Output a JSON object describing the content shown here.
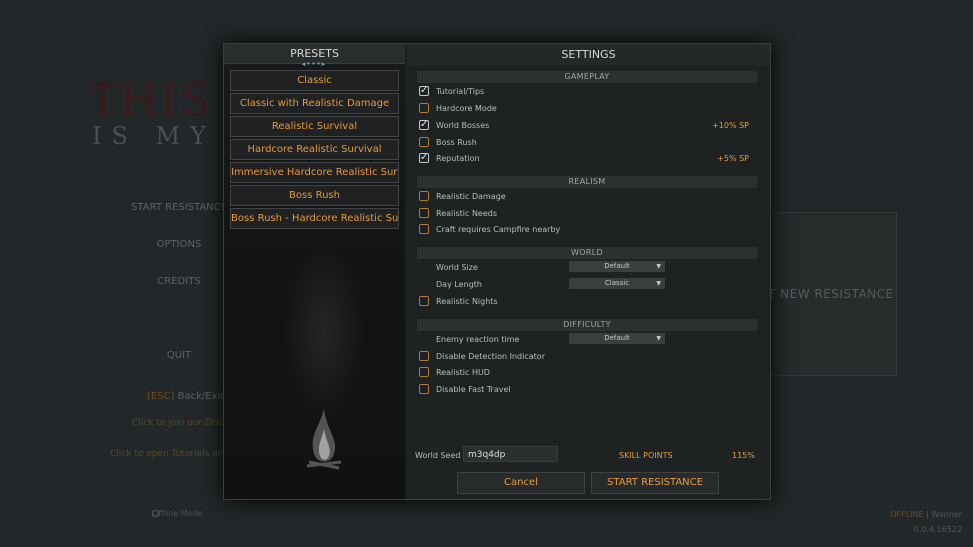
{
  "background": {
    "title_line1": "THIS LA",
    "title_line2": "IS MY L",
    "menu": [
      "START RESISTANCE",
      "OPTIONS",
      "CREDITS",
      "",
      "QUIT"
    ],
    "esc_key": "[ESC]",
    "esc_label": "Back/Exit",
    "discord_link": "Click to join our Discor",
    "tutorials_link": "Click to open Tutorials and G",
    "new_resistance": "T NEW RESISTANCE",
    "offline_mode": "Offline Mode",
    "status_line1_accent": "OFFLINE",
    "status_line1": "| Wanner",
    "version": "0.0.4.16522"
  },
  "presets": {
    "title": "PRESETS",
    "items": [
      "Classic",
      "Classic with Realistic Damage",
      "Realistic Survival",
      "Hardcore Realistic Survival",
      "Immersive Hardcore Realistic Survival",
      "Boss Rush",
      "Boss Rush - Hardcore Realistic Survival"
    ]
  },
  "settings": {
    "title": "SETTINGS",
    "gameplay": {
      "header": "GAMEPLAY",
      "tutorial": {
        "label": "Tutorial/Tips",
        "checked": true
      },
      "hardcore": {
        "label": "Hardcore Mode",
        "checked": false
      },
      "world_bosses": {
        "label": "World Bosses",
        "checked": true,
        "bonus": "+10% SP"
      },
      "boss_rush": {
        "label": "Boss Rush",
        "checked": false
      },
      "reputation": {
        "label": "Reputation",
        "checked": true,
        "bonus": "+5% SP"
      }
    },
    "realism": {
      "header": "REALISM",
      "damage": {
        "label": "Realistic Damage",
        "checked": false
      },
      "needs": {
        "label": "Realistic Needs",
        "checked": false
      },
      "campfire": {
        "label": "Craft requires Campfire nearby",
        "checked": false
      }
    },
    "world": {
      "header": "WORLD",
      "size_label": "World Size",
      "size_value": "Default",
      "day_label": "Day Length",
      "day_value": "Classic",
      "nights": {
        "label": "Realistic Nights",
        "checked": false
      }
    },
    "difficulty": {
      "header": "DIFFICULTY",
      "reaction_label": "Enemy reaction time",
      "reaction_value": "Default",
      "detection": {
        "label": "Disable Detection Indicator",
        "checked": false
      },
      "hud": {
        "label": "Realistic HUD",
        "checked": false
      },
      "fast_travel": {
        "label": "Disable Fast Travel",
        "checked": false
      }
    },
    "seed_label": "World Seed",
    "seed_value": "m3q4dp",
    "skill_points_label": "SKILL POINTS",
    "skill_points_value": "115%",
    "cancel": "Cancel",
    "start": "START RESISTANCE"
  },
  "colors": {
    "accent": "#e89a38",
    "checkbox_border": "#b47a2c",
    "ornament": "#7aa7c7"
  }
}
